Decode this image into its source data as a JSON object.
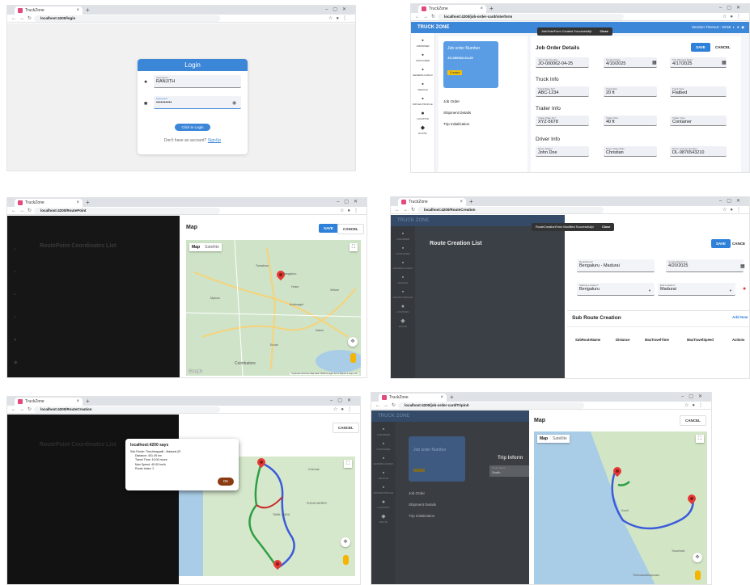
{
  "browser": {
    "tab_title": "TruckZone",
    "url_login": "localhost:4200/login",
    "url_job_order": "localhost:4200/job-order-card/interform",
    "url_route_point": "localhost:4200/RoutePoint",
    "url_route_creation": "localhost:4200/RouteCreation",
    "url_trip": "localhost:4200/job-order-card/Tripinit"
  },
  "brand": "TRUCK ZONE",
  "nav_items": [
    {
      "icon": "briefcase-icon",
      "glyph": "▪",
      "label": "JOBORDER"
    },
    {
      "icon": "container-icon",
      "glyph": "▪",
      "label": "CONTAINER"
    },
    {
      "icon": "cargo-icon",
      "glyph": "▪",
      "label": "GENERALCARGO"
    },
    {
      "icon": "truck-icon",
      "glyph": "▪",
      "label": "VEHICLE"
    },
    {
      "icon": "driver-icon",
      "glyph": "▪",
      "label": "DRIVER PROFILE"
    },
    {
      "icon": "location-icon",
      "glyph": "●",
      "label": "LOCATION"
    },
    {
      "icon": "route-icon",
      "glyph": "◆",
      "label": "ROUTE"
    }
  ],
  "login": {
    "title": "Login",
    "username_label": "Username*",
    "username_value": "RANJITH",
    "password_label": "Password*",
    "password_value": "••••••••••",
    "submit": "Click to Login",
    "signup_prompt": "Don't have an account?",
    "signup_link": "SignUp"
  },
  "job_order": {
    "snackbar": "JobOrderForm Created Successfully!",
    "snackbar_action": "Close",
    "session": "Session Timeout : 19:58",
    "card_title": "Job order Number",
    "card_number": "JO-000062-04-25",
    "status": "Created",
    "side_links": [
      "Job Order",
      "Shipment Details",
      "Trip Initialization"
    ],
    "details_title": "Job Order Details",
    "save": "SAVE",
    "cancel": "CANCEL",
    "fields": [
      {
        "label": "Job Order Number",
        "value": "JO-000062-04-25"
      },
      {
        "label": "Created Date",
        "value": "4/10/2025"
      },
      {
        "label": "Trip Planned Date*",
        "value": "4/17/2025"
      }
    ],
    "truck_title": "Truck Info",
    "truck_fields": [
      {
        "label": "Truck Plate No*",
        "value": "ABC-1234"
      },
      {
        "label": "Truck Size",
        "value": "20 ft"
      },
      {
        "label": "Truck Type",
        "value": "Flatbed"
      }
    ],
    "trailer_title": "Trailer Info",
    "trailer_fields": [
      {
        "label": "Trailer Plate No*",
        "value": "XYZ-5678"
      },
      {
        "label": "Trailer Size",
        "value": "40 ft"
      },
      {
        "label": "Trailer Type",
        "value": "Container"
      }
    ],
    "driver_title": "Driver Info",
    "driver_fields": [
      {
        "label": "Driver Name*",
        "value": "John Doe"
      },
      {
        "label": "Driver Nationality",
        "value": "Christian"
      },
      {
        "label": "Driver License Number",
        "value": "DL-9876543210"
      }
    ]
  },
  "route_point": {
    "list_title": "RoutePoint Coordinates List",
    "map_title": "Map",
    "save": "SAVE",
    "cancel": "CANCEL",
    "map_tab": "Map",
    "satellite_tab": "Satellite",
    "google": "Google",
    "map_footer": "Keyboard shortcuts   Map data ©2025 Google   Terms   Report a map error",
    "places": [
      "Tumakuru",
      "Bengaluru",
      "Hosur",
      "Mysuru",
      "Krishnagiri",
      "Salem",
      "Erode",
      "Coimbatore",
      "Vellore"
    ]
  },
  "route_creation": {
    "snackbar": "RouteCreationForm Modified Successfully!",
    "snackbar_action": "Close",
    "title": "Route Creation List",
    "save": "SAVE",
    "cancel": "CANCE",
    "route_name_label": "RouteName*",
    "route_name": "Bengaluru - Madurai",
    "created_label": "CreatedDateTime",
    "created_value": "4/20/2025",
    "start_label": "Starting Location*",
    "start_value": "Bengaluru",
    "end_label": "End Location*",
    "end_value": "Madurai",
    "sub_title": "Sub Route Creation",
    "add_new": "Add New",
    "columns": [
      "SubRouteName",
      "Distance",
      "MaxTravelTime",
      "MaxTravelSpeed",
      "Actions"
    ]
  },
  "alert": {
    "title": "localhost:4200 says",
    "line1": "Sub Route: Tiruchirappalli - Madurai (R",
    "line2": "Distance: 401.49 km",
    "line3": "Travel Time: 10:00 hours",
    "line4": "Max Speed: 40.00 km/h",
    "line5": "Route Index: 2",
    "ok": "OK",
    "cancel": "CANCEL",
    "list_title": "RoutePoint Coordinates List",
    "places": [
      "Chennai",
      "TAMIL NADU",
      "PUDUCHERRY"
    ]
  },
  "trip": {
    "title": "Map",
    "cancel": "CANCEL",
    "map_tab": "Map",
    "satellite_tab": "Satellite",
    "card_title": "Job order Number",
    "side_links": [
      "Job Order",
      "Shipment Details",
      "Trip Initialization"
    ],
    "trip_heading": "Trip Inform",
    "route_mini": "Route Name",
    "route_mini_value": "South",
    "places": [
      "Kochi",
      "Thiruvananthapuram",
      "Tirunelveli"
    ]
  }
}
